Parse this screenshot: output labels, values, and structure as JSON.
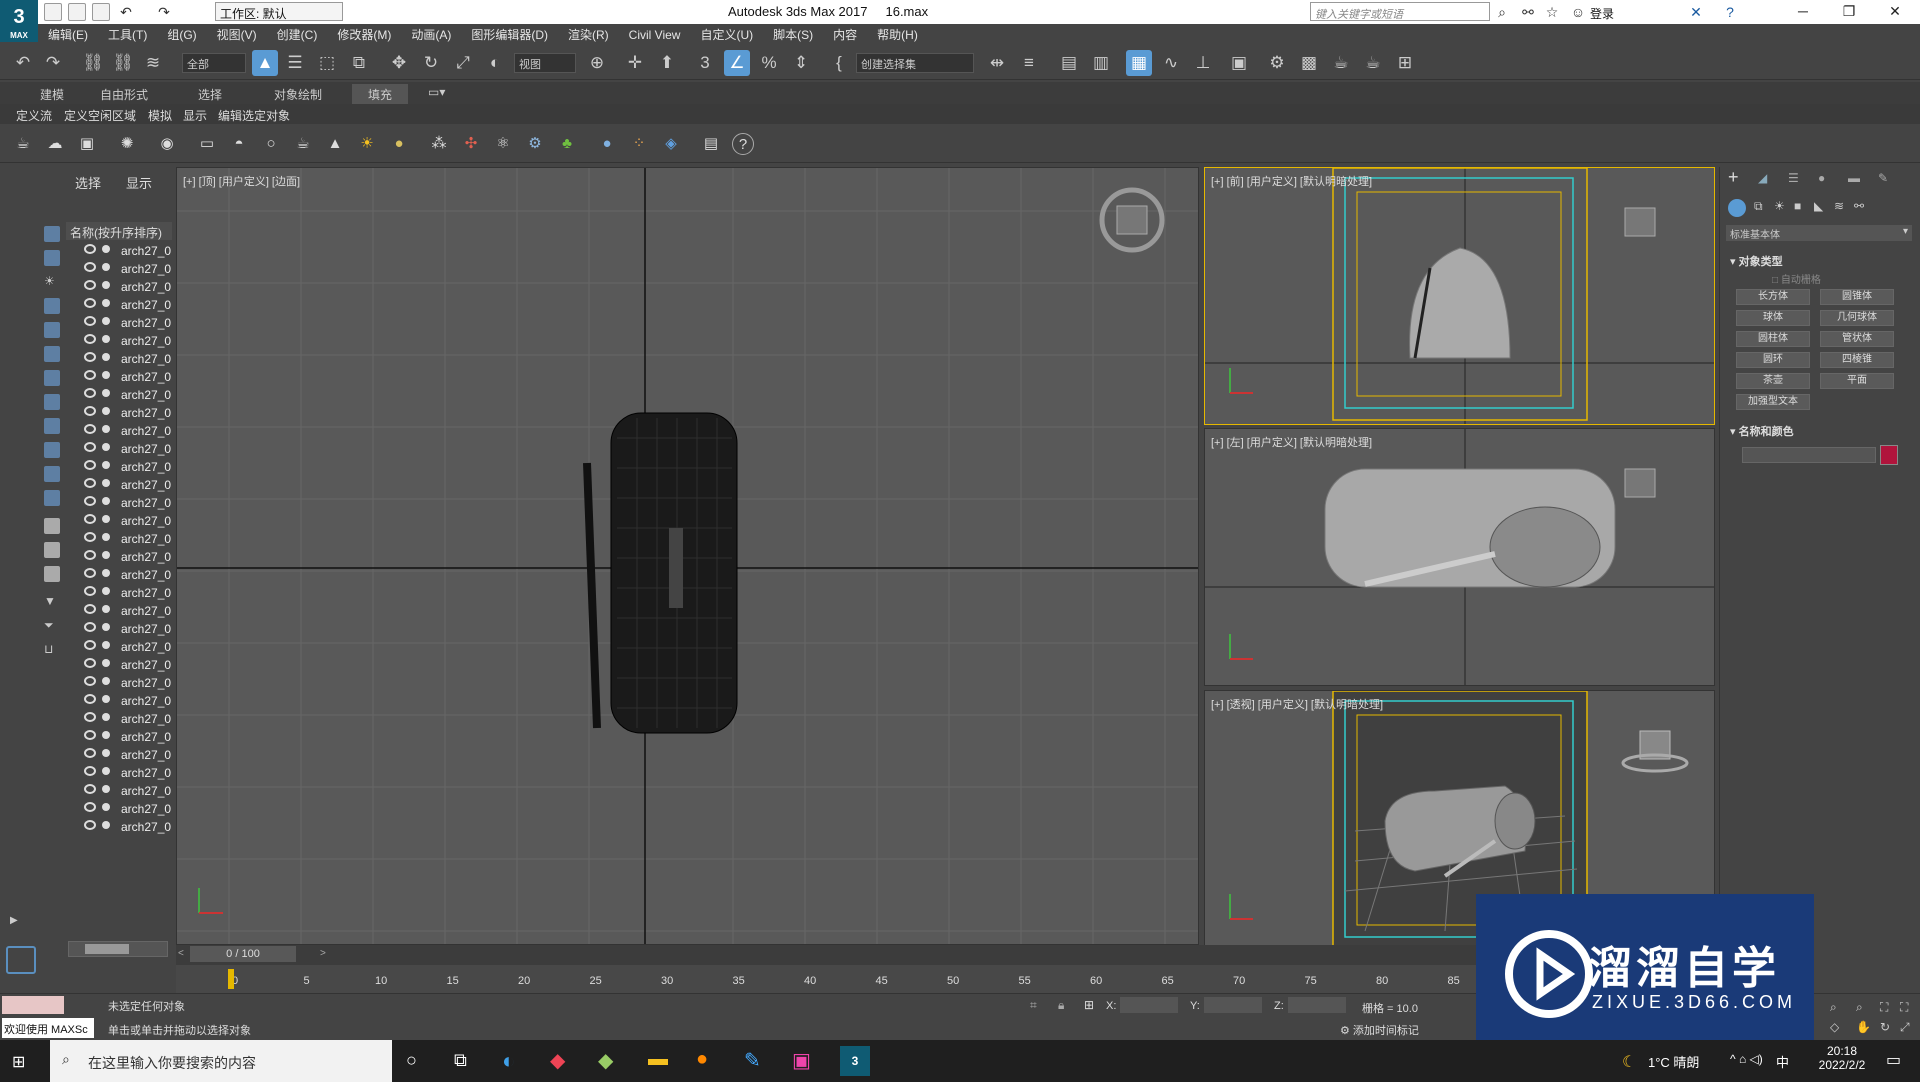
{
  "window": {
    "title": "Autodesk 3ds Max 2017",
    "file": "16.max",
    "workspace": "工作区: 默认",
    "search_placeholder": "键入关键字或短语",
    "login": "登录"
  },
  "menu": [
    "编辑(E)",
    "工具(T)",
    "组(G)",
    "视图(V)",
    "创建(C)",
    "修改器(M)",
    "动画(A)",
    "图形编辑器(D)",
    "渲染(R)",
    "Civil View",
    "自定义(U)",
    "脚本(S)",
    "内容",
    "帮助(H)"
  ],
  "toolbar": {
    "filter": "全部",
    "view": "视图",
    "selection_set": "创建选择集"
  },
  "ribbon_tabs": [
    "建模",
    "自由形式",
    "选择",
    "对象绘制",
    "填充"
  ],
  "ribbon_subtabs": [
    "定义流",
    "定义空闲区域",
    "模拟",
    "显示",
    "编辑选定对象"
  ],
  "scene_explorer": {
    "tabs": [
      "选择",
      "显示"
    ],
    "header": "名称(按升序排序)",
    "items": [
      "arch27_0",
      "arch27_0",
      "arch27_0",
      "arch27_0",
      "arch27_0",
      "arch27_0",
      "arch27_0",
      "arch27_0",
      "arch27_0",
      "arch27_0",
      "arch27_0",
      "arch27_0",
      "arch27_0",
      "arch27_0",
      "arch27_0",
      "arch27_0",
      "arch27_0",
      "arch27_0",
      "arch27_0",
      "arch27_0",
      "arch27_0",
      "arch27_0",
      "arch27_0",
      "arch27_0",
      "arch27_0",
      "arch27_0",
      "arch27_0",
      "arch27_0",
      "arch27_0",
      "arch27_0",
      "arch27_0",
      "arch27_0",
      "arch27_0"
    ]
  },
  "viewports": {
    "top": "[+] [顶] [用户定义] [边面]",
    "front": "[+] [前] [用户定义] [默认明暗处理]",
    "left": "[+] [左] [用户定义] [默认明暗处理]",
    "persp": "[+] [透视] [用户定义] [默认明暗处理]"
  },
  "command_panel": {
    "dropdown": "标准基本体",
    "section1": "对象类型",
    "autogrid": "自动栅格",
    "buttons": [
      "长方体",
      "圆锥体",
      "球体",
      "几何球体",
      "圆柱体",
      "管状体",
      "圆环",
      "四棱锥",
      "茶壶",
      "平面",
      "加强型文本"
    ],
    "section2": "名称和颜色",
    "color": "#b0143c"
  },
  "timeline": {
    "frame": "0 / 100",
    "ticks": [
      "0",
      "5",
      "10",
      "15",
      "20",
      "25",
      "30",
      "35",
      "40",
      "45",
      "50",
      "55",
      "60",
      "65",
      "70",
      "75",
      "80",
      "85"
    ]
  },
  "status": {
    "welcome": "欢迎使用 MAXSc",
    "line1": "未选定任何对象",
    "line2": "单击或单击并拖动以选择对象",
    "x": "X:",
    "y": "Y:",
    "z": "Z:",
    "grid": "栅格 = 10.0",
    "add_tag": "添加时间标记"
  },
  "taskbar": {
    "search": "在这里输入你要搜索的内容",
    "weather": "1°C 晴朗",
    "time": "20:18",
    "date": "2022/2/2",
    "ime": "中"
  },
  "watermark": {
    "title": "溜溜自学",
    "url": "ZIXUE.3D66.COM"
  }
}
